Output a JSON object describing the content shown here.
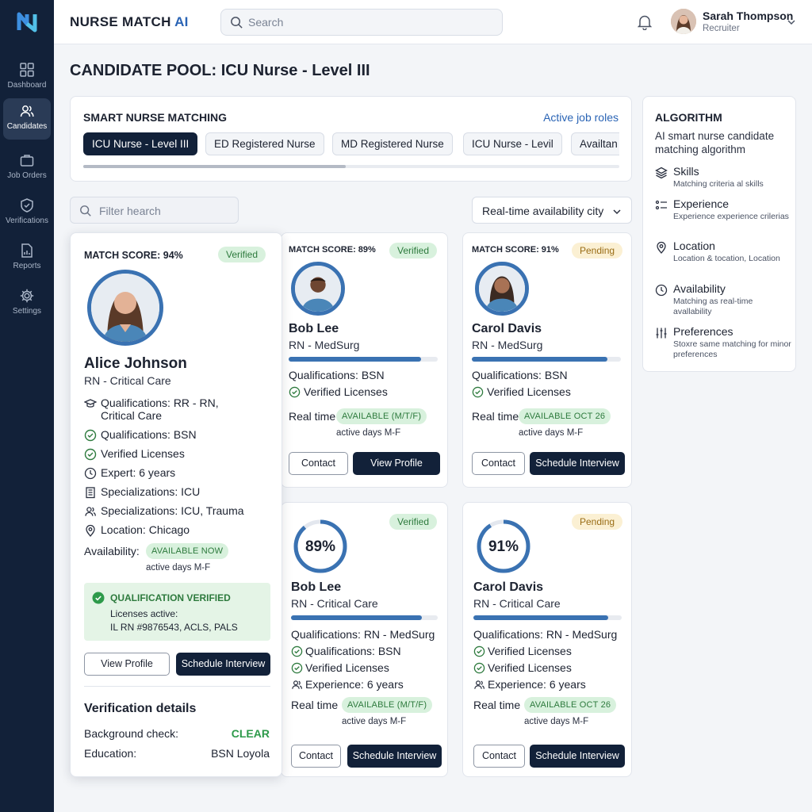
{
  "app": {
    "brand": "NURSE MATCH",
    "brand_accent": "AI"
  },
  "sidebar": {
    "items": [
      {
        "label": "Dashboard",
        "icon": "dashboard-icon"
      },
      {
        "label": "Candidates",
        "icon": "users-icon",
        "active": true
      },
      {
        "label": "Job Orders",
        "icon": "briefcase-icon"
      },
      {
        "label": "Verifications",
        "icon": "shield-check-icon"
      },
      {
        "label": "Reports",
        "icon": "report-icon"
      },
      {
        "label": "Settings",
        "icon": "gear-icon"
      }
    ]
  },
  "header": {
    "search_placeholder": "Search",
    "user": {
      "name": "Sarah Thompson",
      "role": "Recruiter"
    }
  },
  "page_title": "CANDIDATE POOL: ICU Nurse - Level III",
  "matching": {
    "title": "SMART NURSE MATCHING",
    "link": "Active job roles",
    "roles": [
      "ICU Nurse - Level III",
      "ED Registered Nurse",
      "MD Registered Nurse",
      "ICU Nurse - Levil",
      "Availtan"
    ],
    "active_role_index": 0,
    "scroll_fraction": 0.49
  },
  "algorithm": {
    "title": "ALGORITHM",
    "description": "AI smart nurse candidate matching algorithm",
    "items": [
      {
        "title": "Skills",
        "desc": "Matching criteria al skills",
        "icon": "layers-icon"
      },
      {
        "title": "Experience",
        "desc": "Experience experience crilerias",
        "icon": "list-icon"
      },
      {
        "title": "Location",
        "desc": "Location & tocation, Location",
        "icon": "location-pin-icon"
      },
      {
        "title": "Availability",
        "desc": "Matching as real-time avallability",
        "icon": "clock-icon"
      },
      {
        "title": "Preferences",
        "desc": "Stoxre same matching for minor preferences",
        "icon": "sliders-icon"
      }
    ]
  },
  "filters": {
    "search_placeholder": "Filter hearch",
    "availability_select": "Real-time availability city"
  },
  "featured": {
    "match_score": "MATCH SCORE: 94%",
    "status": "Verified",
    "name": "Alice Johnson",
    "role": "RN - Critical Care",
    "details": [
      {
        "icon": "graduation-cap-icon",
        "text": "Qualifications: RR - RN,",
        "text2": "Critical Care"
      },
      {
        "icon": "check-circle-icon",
        "text": "Qualifications: BSN"
      },
      {
        "icon": "check-circle-icon",
        "text": "Verified Licenses"
      },
      {
        "icon": "clock-icon",
        "text": "Expert: 6 years"
      },
      {
        "icon": "building-icon",
        "text": "Specializations: ICU"
      },
      {
        "icon": "users-icon",
        "text": "Specializations: ICU, Trauma"
      },
      {
        "icon": "location-pin-icon",
        "text": "Location: Chicago"
      }
    ],
    "availability_label": "Availability:",
    "availability_badge": "AVAILABLE NOW",
    "availability_days": "active days M-F",
    "qualification_box": {
      "title": "QUALIFICATION VERIFIED",
      "line1": "Licenses active:",
      "line2": "IL RN #9876543, ACLS, PALS"
    },
    "buttons": {
      "view": "View Profile",
      "schedule": "Schedule Interview"
    },
    "verification": {
      "title": "Verification details",
      "rows": [
        {
          "label": "Background check:",
          "value": "CLEAR"
        },
        {
          "label": "Education:",
          "value": "BSN Loyola"
        }
      ]
    }
  },
  "cards": [
    {
      "match_score": "MATCH SCORE: 89%",
      "status": "Verified",
      "name": "Bob Lee",
      "role": "RN - MedSurg",
      "progress": 0.89,
      "lines": [
        "Qualifications: BSN",
        "Verified Licenses"
      ],
      "realtime_label": "Real time",
      "availability": "AVAILABLE (M/T/F)",
      "days": "active days M-F",
      "buttons": [
        "Contact",
        "View Profile"
      ]
    },
    {
      "match_score": "MATCH SCORE: 91%",
      "status": "Pending",
      "name": "Carol Davis",
      "role": "RN - MedSurg",
      "progress": 0.91,
      "lines": [
        "Qualifications: BSN",
        "Verified Licenses"
      ],
      "realtime_label": "Real time",
      "availability": "AVAILABLE OCT 26",
      "days": "active days M-F",
      "buttons": [
        "Contact",
        "Schedule Interview"
      ]
    },
    {
      "percent": "89%",
      "percent_value": 0.89,
      "status": "Verified",
      "name": "Bob Lee",
      "role": "RN - Critical Care",
      "progress": 0.89,
      "lines": [
        "Qualifications: RN - MedSurg",
        "Qualifications: BSN",
        "Verified Licenses",
        "Experience: 6 years"
      ],
      "realtime_label": "Real time",
      "availability": "AVAILABLE (M/T/F)",
      "days": "active days M-F",
      "buttons": [
        "Contact",
        "Schedule Interview"
      ]
    },
    {
      "percent": "91%",
      "percent_value": 0.91,
      "status": "Pending",
      "name": "Carol Davis",
      "role": "RN - Critical Care",
      "progress": 0.91,
      "lines": [
        "Qualifications: RN - MedSurg",
        "Verified Licenses",
        "Verified Licenses",
        "Experience: 6 years"
      ],
      "realtime_label": "Real time",
      "availability": "AVAILABLE OCT 26",
      "days": "active days M-F",
      "buttons": [
        "Contact",
        "Schedule Interview"
      ]
    }
  ],
  "colors": {
    "sidebar": "#122139",
    "accent": "#2a64b5",
    "ring": "#3a72b2",
    "verified_bg": "#d8f1dd",
    "verified_text": "#2d7a3d",
    "pending_bg": "#fbf0d3",
    "pending_text": "#9a6d16"
  }
}
